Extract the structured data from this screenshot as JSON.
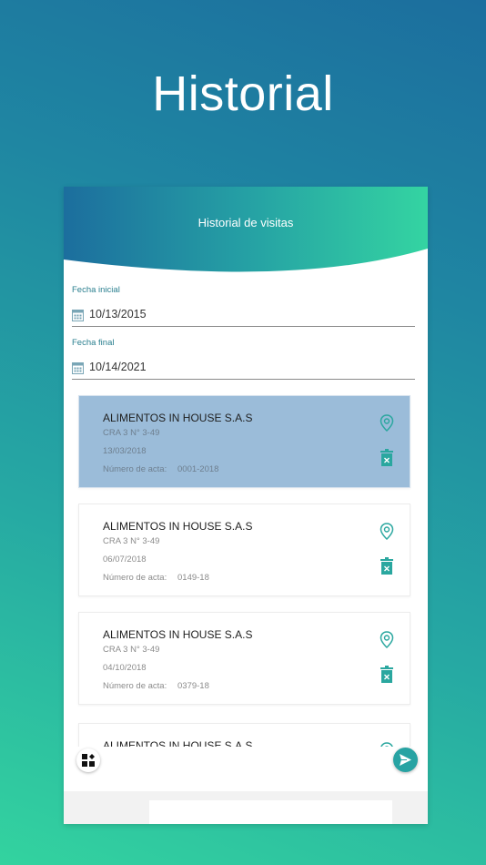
{
  "hero": {
    "title": "Historial"
  },
  "header": {
    "title": "Historial de visitas"
  },
  "filters": {
    "start_label": "Fecha inicial",
    "start_value": "10/13/2015",
    "end_label": "Fecha final",
    "end_value": "10/14/2021"
  },
  "visits": [
    {
      "name": "ALIMENTOS IN HOUSE S.A.S",
      "address": "CRA 3 N° 3-49",
      "date": "13/03/2018",
      "acta_label": "Número de acta:",
      "acta": "0001-2018",
      "selected": true
    },
    {
      "name": "ALIMENTOS IN HOUSE S.A.S",
      "address": "CRA 3 N° 3-49",
      "date": "06/07/2018",
      "acta_label": "Número de acta:",
      "acta": "0149-18",
      "selected": false
    },
    {
      "name": "ALIMENTOS IN HOUSE S.A.S",
      "address": "CRA 3 N° 3-49",
      "date": "04/10/2018",
      "acta_label": "Número de acta:",
      "acta": "0379-18",
      "selected": false
    },
    {
      "name": "ALIMENTOS IN HOUSE S.A.S",
      "address": "",
      "date": "",
      "acta_label": "",
      "acta": "",
      "selected": false
    }
  ],
  "icons": {
    "calendar": "calendar-icon",
    "location": "location-pin-icon",
    "delete": "trash-icon",
    "dashboard": "dashboard-icon",
    "send": "send-icon"
  },
  "colors": {
    "accent": "#27a3a3",
    "selected_card": "#9bbcd9",
    "label": "#2a7f8f"
  }
}
